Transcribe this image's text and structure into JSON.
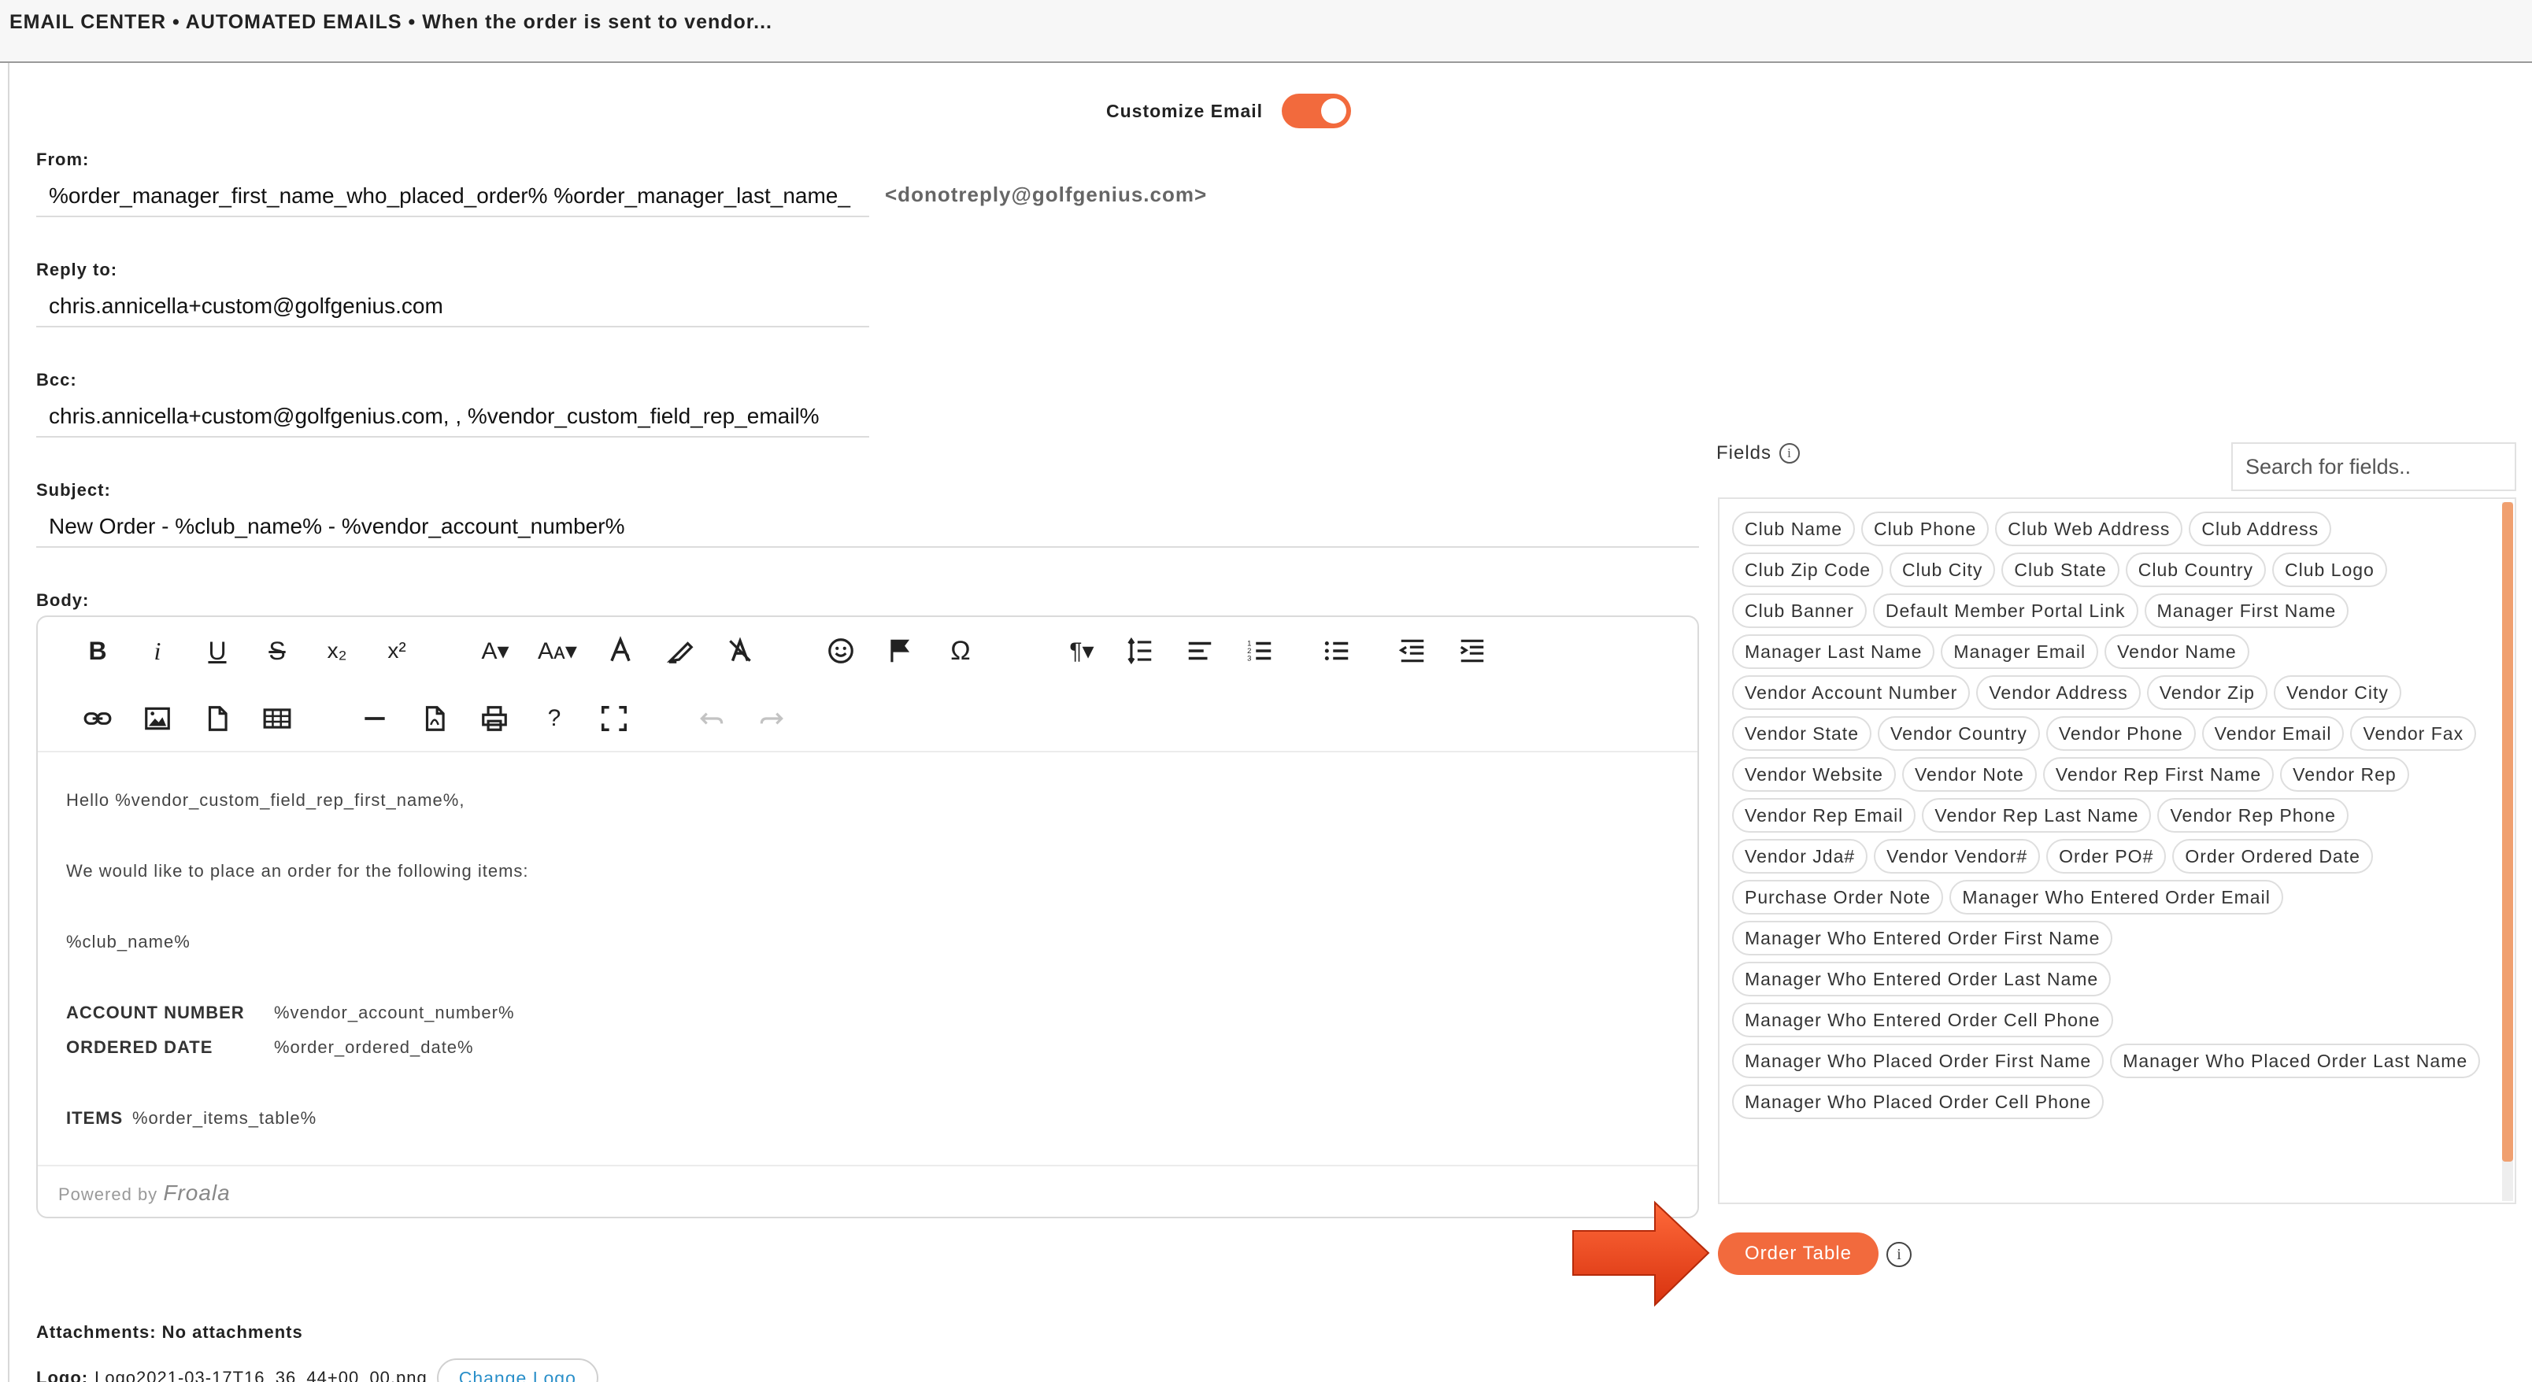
{
  "header": {
    "breadcrumb": "EMAIL CENTER • AUTOMATED EMAILS • When the order is sent to vendor..."
  },
  "customize": {
    "label": "Customize Email",
    "enabled": true
  },
  "from": {
    "label": "From:",
    "value": "%order_manager_first_name_who_placed_order% %order_manager_last_name_",
    "email": "<donotreply@golfgenius.com>"
  },
  "reply_to": {
    "label": "Reply to:",
    "value": "chris.annicella+custom@golfgenius.com"
  },
  "bcc": {
    "label": "Bcc:",
    "value": "chris.annicella+custom@golfgenius.com, , %vendor_custom_field_rep_email%"
  },
  "subject": {
    "label": "Subject:",
    "value": "New Order - %club_name% - %vendor_account_number%"
  },
  "body": {
    "label": "Body:",
    "greeting": "Hello %vendor_custom_field_rep_first_name%,",
    "intro": "We would like to place an order for the following items:",
    "club": "%club_name%",
    "account_label": "ACCOUNT NUMBER",
    "account_value": "%vendor_account_number%",
    "ordered_label": "ORDERED DATE",
    "ordered_value": "%order_ordered_date%",
    "items_label": "ITEMS",
    "items_value": "%order_items_table%",
    "powered_by": "Powered by",
    "powered_brand": "Froala"
  },
  "toolbar": {
    "bold": "B",
    "italic": "i",
    "underline": "U",
    "strike": "S",
    "subscript": "x₂",
    "superscript": "x²",
    "font_family": "A▾",
    "font_size": "Aᴀ▾",
    "special_chars": "Ω",
    "paragraph": "¶▾",
    "help": "?"
  },
  "fields": {
    "label": "Fields",
    "search_placeholder": "Search for fields..",
    "items": [
      "Club Name",
      "Club Phone",
      "Club Web Address",
      "Club Address",
      "Club Zip Code",
      "Club City",
      "Club State",
      "Club Country",
      "Club Logo",
      "Club Banner",
      "Default Member Portal Link",
      "Manager First Name",
      "Manager Last Name",
      "Manager Email",
      "Vendor Name",
      "Vendor Account Number",
      "Vendor Address",
      "Vendor Zip",
      "Vendor City",
      "Vendor State",
      "Vendor Country",
      "Vendor Phone",
      "Vendor Email",
      "Vendor Fax",
      "Vendor Website",
      "Vendor Note",
      "Vendor Rep First Name",
      "Vendor Rep",
      "Vendor Rep Email",
      "Vendor Rep Last Name",
      "Vendor Rep Phone",
      "Vendor Jda#",
      "Vendor Vendor#",
      "Order PO#",
      "Order Ordered Date",
      "Purchase Order Note",
      "Manager Who Entered Order Email",
      "Manager Who Entered Order First Name",
      "Manager Who Entered Order Last Name",
      "Manager Who Entered Order Cell Phone",
      "Manager Who Placed Order First Name",
      "Manager Who Placed Order Last Name",
      "Manager Who Placed Order Cell Phone"
    ]
  },
  "order_table_button": "Order Table",
  "attachments": {
    "text": "Attachments: No attachments"
  },
  "logo": {
    "label": "Logo:",
    "filename": "Logo2021-03-17T16_36_44+00_00.png",
    "change_label": "Change Logo"
  },
  "colors": {
    "accent": "#f26a3d",
    "link": "#2a8fc9",
    "arrow": "#e8451b"
  }
}
